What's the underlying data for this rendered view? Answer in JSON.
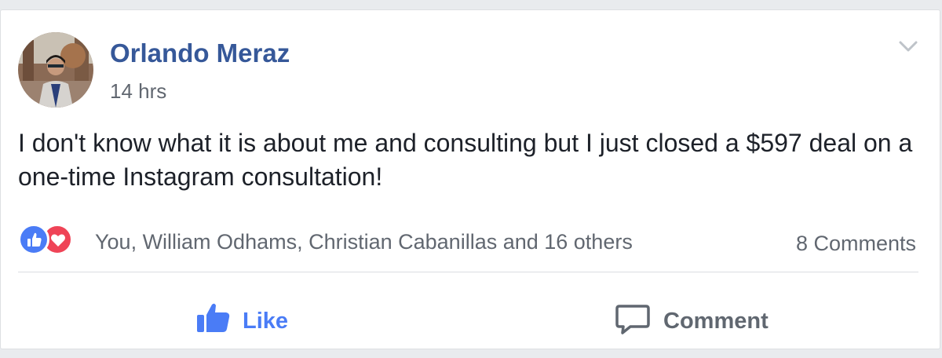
{
  "post": {
    "author": "Orlando Meraz",
    "timestamp": "14 hrs",
    "text": "I don't know what it is about me and consulting but I just closed a $597 deal on a one-time Instagram consultation!"
  },
  "reactions": {
    "icons": [
      "like-icon",
      "love-icon"
    ],
    "summary": "You, William Odhams, Christian Cabanillas and 16 others",
    "comments": "8 Comments"
  },
  "actions": {
    "like_label": "Like",
    "comment_label": "Comment"
  },
  "colors": {
    "author": "#365899",
    "like_active": "#4a7cf6",
    "love": "#ef4457",
    "secondary_text": "#616770"
  }
}
